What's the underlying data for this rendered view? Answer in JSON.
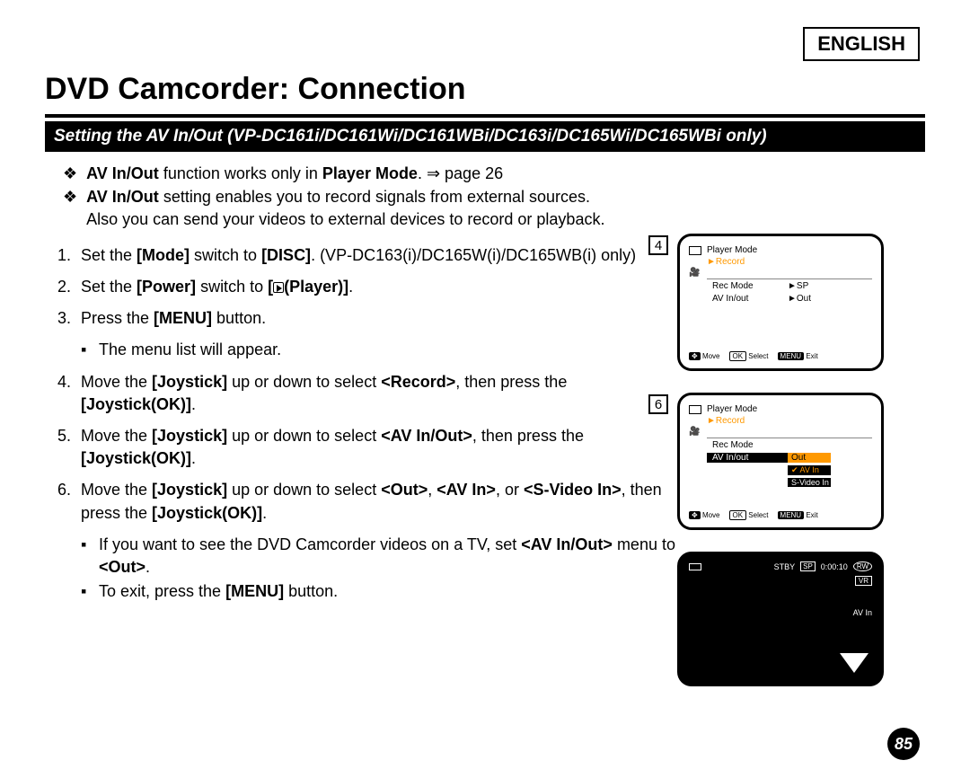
{
  "language_tag": "ENGLISH",
  "page_title": "DVD Camcorder: Connection",
  "subheading": "Setting the AV In/Out (VP-DC161i/DC161Wi/DC161WBi/DC163i/DC165Wi/DC165WBi only)",
  "intro": {
    "b1_pre": "AV In/Out",
    "b1_mid": " function works only in ",
    "b1_bold2": "Player Mode",
    "b1_post": ".  ⇒ page 26",
    "b2_pre": "AV In/Out",
    "b2_post": " setting enables you to record signals from external sources.",
    "b2_line2": "Also you can send your videos to external devices to record or playback."
  },
  "steps": {
    "s1_a": "Set the ",
    "s1_b": "[Mode]",
    "s1_c": " switch to ",
    "s1_d": "[DISC]",
    "s1_e": ". (VP-DC163(i)/DC165W(i)/DC165WB(i) only)",
    "s2_a": "Set the ",
    "s2_b": "[Power]",
    "s2_c": " switch to ",
    "s2_d": "[",
    "s2_e": "(Player)]",
    "s2_f": ".",
    "s3_a": "Press the ",
    "s3_b": "[MENU]",
    "s3_c": " button.",
    "s3_sub": "The menu list will appear.",
    "s4_a": "Move the ",
    "s4_b": "[Joystick]",
    "s4_c": " up or down to select ",
    "s4_d": "<Record>",
    "s4_e": ", then press the ",
    "s4_f": "[Joystick(OK)]",
    "s4_g": ".",
    "s5_a": "Move the ",
    "s5_b": "[Joystick]",
    "s5_c": " up or down to select ",
    "s5_d": "<AV In/Out>",
    "s5_e": ", then press the ",
    "s5_f": "[Joystick(OK)]",
    "s5_g": ".",
    "s6_a": "Move the ",
    "s6_b": "[Joystick]",
    "s6_c": " up or down to select ",
    "s6_d": "<Out>",
    "s6_e": ", ",
    "s6_f": "<AV In>",
    "s6_g": ", or ",
    "s6_h": "<S-Video In>",
    "s6_i": ", then press the ",
    "s6_j": "[Joystick(OK)]",
    "s6_k": ".",
    "s6_sub1_a": "If you want to see the DVD Camcorder videos on a TV, set ",
    "s6_sub1_b": "<AV In/Out>",
    "s6_sub1_c": " menu to ",
    "s6_sub1_d": "<Out>",
    "s6_sub1_e": ".",
    "s6_sub2_a": "To exit, press the ",
    "s6_sub2_b": "[MENU]",
    "s6_sub2_c": " button."
  },
  "figures": {
    "f4": {
      "num": "4",
      "mode_label": "Player Mode",
      "section": "►Record",
      "rows": [
        {
          "l": "Rec Mode",
          "r": "►SP"
        },
        {
          "l": "AV In/out",
          "r": "►Out"
        }
      ],
      "footer": {
        "move": "Move",
        "select": "Select",
        "exit": "Exit",
        "ok": "OK",
        "menu": "MENU"
      }
    },
    "f6": {
      "num": "6",
      "mode_label": "Player Mode",
      "section": "►Record",
      "rows_plain": [
        {
          "l": "Rec Mode",
          "r": ""
        }
      ],
      "row_hi": {
        "l": "AV In/out",
        "r": "Out"
      },
      "sub_options": [
        "✔ AV In",
        "S-Video In"
      ],
      "footer": {
        "move": "Move",
        "select": "Select",
        "exit": "Exit",
        "ok": "OK",
        "menu": "MENU"
      }
    },
    "preview": {
      "stby": "STBY",
      "sp": "SP",
      "time": "0:00:10",
      "rw": "RW",
      "vr": "VR",
      "avin": "AV In"
    }
  },
  "page_number": "85"
}
